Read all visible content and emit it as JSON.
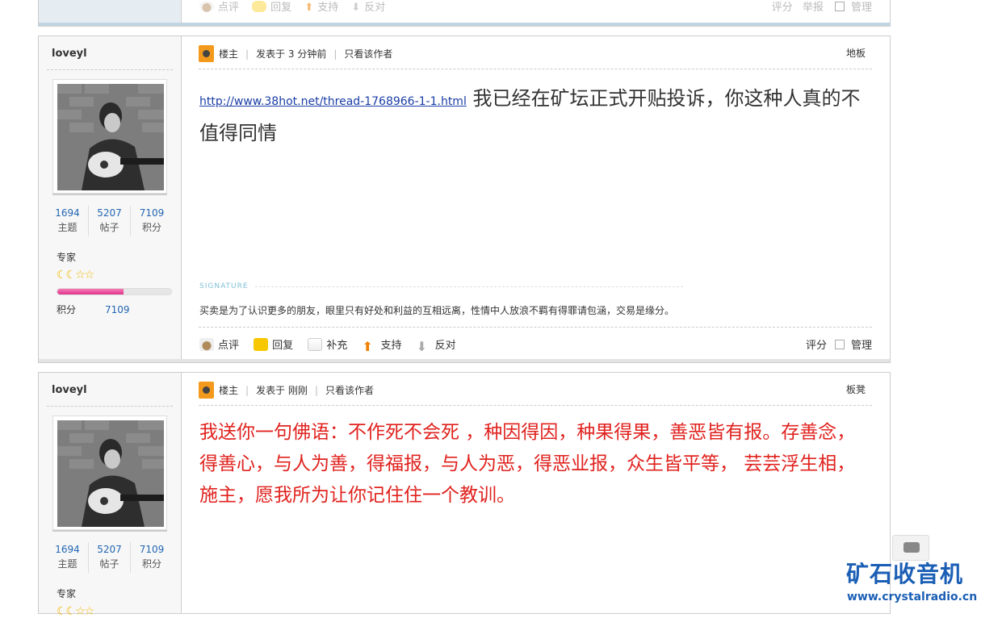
{
  "top_post": {
    "actions": [
      "点评",
      "回复",
      "支持",
      "反对"
    ],
    "right": [
      "评分",
      "举报",
      "管理"
    ]
  },
  "posts": [
    {
      "username": "loveyl",
      "stats": [
        {
          "num": "1694",
          "label": "主题"
        },
        {
          "num": "5207",
          "label": "帖子"
        },
        {
          "num": "7109",
          "label": "积分"
        }
      ],
      "rank": "专家",
      "progress": 0.58,
      "score_label": "积分",
      "score_value": "7109",
      "role": "楼主",
      "posted": "发表于 3 分钟前",
      "only_author": "只看该作者",
      "floor": "地板",
      "link": "http://www.38hot.net/thread-1768966-1-1.html",
      "text": "我已经在矿坛正式开贴投诉，你这种人真的不值得同情",
      "signature_label": "SIGNATURE",
      "signature": "买卖是为了认识更多的朋友，眼里只有好处和利益的互相远离，性情中人放浪不羁有得罪请包涵，交易是缘分。",
      "actions": [
        "点评",
        "回复",
        "补充",
        "支持",
        "反对"
      ],
      "right_actions": [
        "评分",
        "管理"
      ]
    },
    {
      "username": "loveyl",
      "stats": [
        {
          "num": "1694",
          "label": "主题"
        },
        {
          "num": "5207",
          "label": "帖子"
        },
        {
          "num": "7109",
          "label": "积分"
        }
      ],
      "rank": "专家",
      "role": "楼主",
      "posted": "发表于 刚刚",
      "only_author": "只看该作者",
      "floor": "板凳",
      "text": "我送你一句佛语：不作死不会死 ，种因得因，种果得果，善恶皆有报。存善念，得善心，与人为善，得福报，与人为恶，得恶业报，众生皆平等， 芸芸浮生相，施主，愿我所为让你记住住一个教训。"
    }
  ],
  "logo": {
    "text": "矿石收音机",
    "url": "www.crystalradio.cn"
  },
  "colors": {
    "link": "#2166b3",
    "red_text": "#e0221e",
    "brand_blue": "#1b5fb5"
  }
}
